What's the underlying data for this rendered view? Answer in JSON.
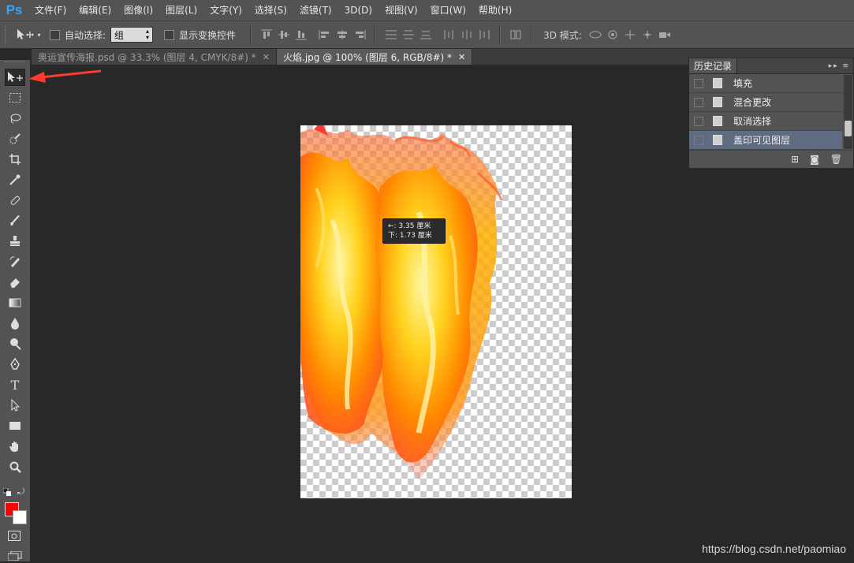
{
  "app": {
    "logo": "Ps",
    "brand_color": "#31a8ff"
  },
  "menu": [
    "文件(F)",
    "编辑(E)",
    "图像(I)",
    "图层(L)",
    "文字(Y)",
    "选择(S)",
    "滤镜(T)",
    "3D(D)",
    "视图(V)",
    "窗口(W)",
    "帮助(H)"
  ],
  "options": {
    "auto_select_label": "自动选择:",
    "auto_select_value": "组",
    "show_transform_label": "显示变换控件",
    "mode_3d_label": "3D 模式:"
  },
  "tabs": [
    {
      "label": "奥运宣传海报.psd @ 33.3% (图层 4, CMYK/8#) *",
      "active": false
    },
    {
      "label": "火焰.jpg @ 100% (图层 6, RGB/8#) *",
      "active": true
    }
  ],
  "hud": {
    "line1": "←: 3.35 厘米",
    "line2": "下: 1.73 厘米"
  },
  "history": {
    "title": "历史记录",
    "items": [
      {
        "label": "填充",
        "selected": false
      },
      {
        "label": "混合更改",
        "selected": false
      },
      {
        "label": "取消选择",
        "selected": false
      },
      {
        "label": "盖印可见图层",
        "selected": true
      }
    ]
  },
  "colors": {
    "foreground": "#ff0000",
    "background": "#ffffff",
    "arrow": "#ff3b30"
  },
  "watermark": "https://blog.csdn.net/paomiao"
}
